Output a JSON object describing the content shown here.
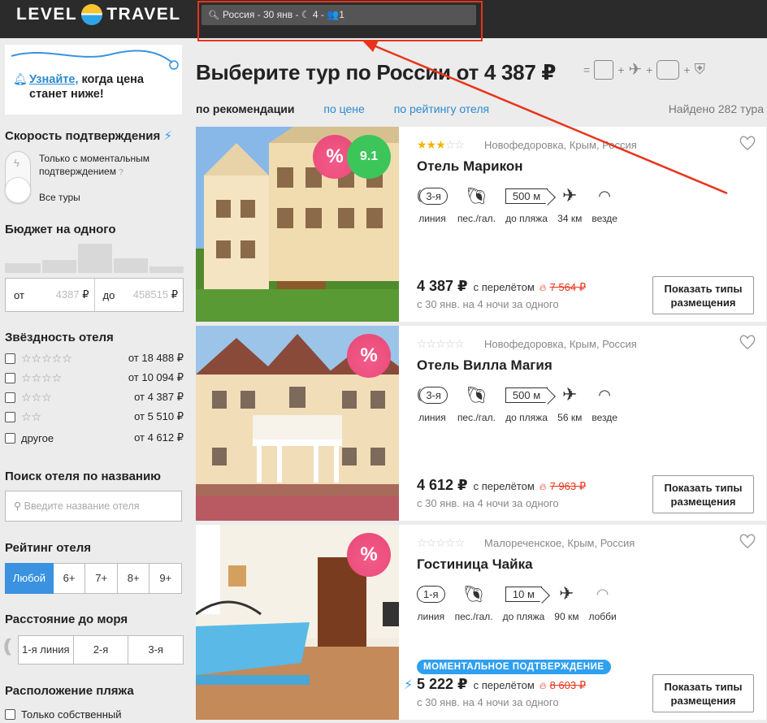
{
  "header": {
    "logo_left": "LEVEL",
    "logo_right": "TRAVEL",
    "search_summary": "Россия - 30 янв - ☾ 4 - 👥1"
  },
  "sidebar": {
    "notify_link": "Узнайте,",
    "notify_text1": " когда цена",
    "notify_text2": "станет ниже!",
    "speed_title": "Скорость подтверждения",
    "speed_opt1a": "Только с моментальным",
    "speed_opt1b": "подтверждением",
    "speed_help": "?",
    "speed_opt2": "Все туры",
    "budget_title": "Бюджет на одного",
    "budget_from_label": "от",
    "budget_from_placeholder": "4387",
    "budget_to_label": "до",
    "budget_to_placeholder": "458515",
    "currency": "₽",
    "stars_title": "Звёздность отеля",
    "star_rows": [
      {
        "stars": "☆☆☆☆☆",
        "price": "от 18 488 ₽"
      },
      {
        "stars": "☆☆☆☆",
        "price": "от 10 094 ₽"
      },
      {
        "stars": "☆☆☆",
        "price": "от 4 387 ₽"
      },
      {
        "stars": "☆☆",
        "price": "от 5 510 ₽"
      },
      {
        "stars": "другое",
        "price": "от 4 612 ₽"
      }
    ],
    "name_search_title": "Поиск отеля по названию",
    "name_search_placeholder": "Введите название отеля",
    "rating_title": "Рейтинг отеля",
    "rating_options": [
      "Любой",
      "6+",
      "7+",
      "8+",
      "9+"
    ],
    "distance_title": "Расстояние до моря",
    "distance_options": [
      "1-я линия",
      "2-я",
      "3-я"
    ],
    "beach_title": "Расположение пляжа",
    "beach_opt1": "Только собственный"
  },
  "main": {
    "title": "Выберите тур по России от 4 387 ₽",
    "formula_eq": "=",
    "sort": [
      "по рекомендации",
      "по цене",
      "по рейтингу отеля"
    ],
    "found": "Найдено 282 тура"
  },
  "cards": [
    {
      "location": "Новофедоровка, Крым, Россия",
      "name": "Отель Марикон",
      "score": "9.1",
      "line": "3-я",
      "line_label": "линия",
      "beach_label": "пес./гал.",
      "dist": "500 м",
      "dist_label": "до пляжа",
      "airport": "34 км",
      "wifi": "везде",
      "price": "4 387 ₽",
      "price_note": "с перелётом",
      "old_price": "7 564 ₽",
      "sub": "с 30 янв. на 4 ночи за одного",
      "button": "Показать типы размещения"
    },
    {
      "location": "Новофедоровка, Крым, Россия",
      "name": "Отель Вилла Магия",
      "line": "3-я",
      "line_label": "линия",
      "beach_label": "пес./гал.",
      "dist": "500 м",
      "dist_label": "до пляжа",
      "airport": "56 км",
      "wifi": "везде",
      "price": "4 612 ₽",
      "price_note": "с перелётом",
      "old_price": "7 963 ₽",
      "sub": "с 30 янв. на 4 ночи за одного",
      "button": "Показать типы размещения"
    },
    {
      "location": "Малореченское, Крым, Россия",
      "name": "Гостиница Чайка",
      "line": "1-я",
      "line_label": "линия",
      "beach_label": "пес./гал.",
      "dist": "10 м",
      "dist_label": "до пляжа",
      "airport": "90 км",
      "wifi": "лобби",
      "badge": "МОМЕНТАЛЬНОЕ ПОДТВЕРЖДЕНИЕ",
      "price": "5 222 ₽",
      "price_note": "с перелётом",
      "old_price": "8 603 ₽",
      "sub": "с 30 янв. на 4 ночи за одного",
      "button": "Показать типы размещения"
    }
  ],
  "colors": {
    "accent": "#2a8ad0",
    "highlight": "#e8341c",
    "discount": "#e94876",
    "score": "#3cc65a"
  }
}
